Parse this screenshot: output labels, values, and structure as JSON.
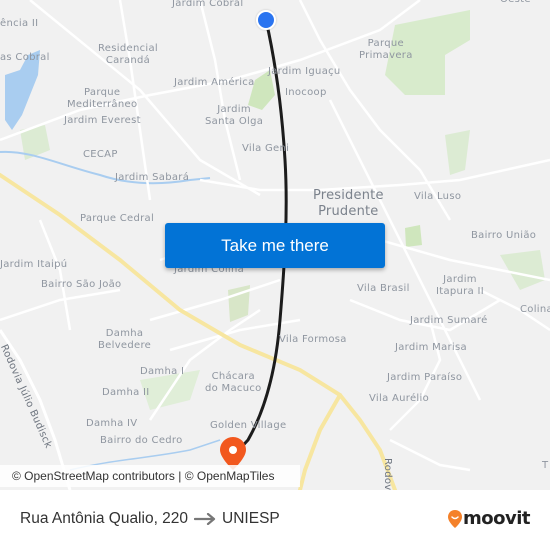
{
  "map": {
    "city_label": [
      "Presidente",
      "Prudente"
    ],
    "labels": [
      {
        "id": "jardim-cobral",
        "text": [
          "Jardim Cobral"
        ]
      },
      {
        "id": "residencia-ii",
        "text": [
          "ência II"
        ]
      },
      {
        "id": "cobral-west",
        "text": [
          "as Cobral"
        ]
      },
      {
        "id": "residencial-caranda",
        "text": [
          "Residencial",
          "Carandá"
        ]
      },
      {
        "id": "parque-mediterraneo",
        "text": [
          "Parque",
          "Mediterrâneo"
        ]
      },
      {
        "id": "jardim-everest",
        "text": [
          "Jardim Everest"
        ]
      },
      {
        "id": "jardim-america",
        "text": [
          "Jardim América"
        ]
      },
      {
        "id": "jardim-santa-olga",
        "text": [
          "Jardim",
          "Santa Olga"
        ]
      },
      {
        "id": "jardim-iguacu",
        "text": [
          "Jardim Iguaçu"
        ]
      },
      {
        "id": "inocoop",
        "text": [
          "Inocoop"
        ]
      },
      {
        "id": "parque-primavera",
        "text": [
          "Parque",
          "Primavera"
        ]
      },
      {
        "id": "oeste",
        "text": [
          "Oeste"
        ]
      },
      {
        "id": "cecap",
        "text": [
          "CECAP"
        ]
      },
      {
        "id": "vila-geni",
        "text": [
          "Vila Geni"
        ]
      },
      {
        "id": "jardim-sabara",
        "text": [
          "Jardim Sabará"
        ]
      },
      {
        "id": "parque-cedral",
        "text": [
          "Parque Cedral"
        ]
      },
      {
        "id": "vila-luso",
        "text": [
          "Vila Luso"
        ]
      },
      {
        "id": "bairro-uniao",
        "text": [
          "Bairro União"
        ]
      },
      {
        "id": "jardim-itaipu",
        "text": [
          "Jardim Itaipú"
        ]
      },
      {
        "id": "jardim-colina",
        "text": [
          "Jardim Colina"
        ]
      },
      {
        "id": "bairro-sao-joao",
        "text": [
          "Bairro São João"
        ]
      },
      {
        "id": "vila-brasil",
        "text": [
          "Vila Brasil"
        ]
      },
      {
        "id": "jardim-itapura-ii",
        "text": [
          "Jardim",
          "Itapura II"
        ]
      },
      {
        "id": "jardim-sumare",
        "text": [
          "Jardim Sumaré"
        ]
      },
      {
        "id": "colina",
        "text": [
          "Colina"
        ]
      },
      {
        "id": "damha-belvedere",
        "text": [
          "Damha",
          "Belvedere"
        ]
      },
      {
        "id": "vila-formosa",
        "text": [
          "Vila Formosa"
        ]
      },
      {
        "id": "jardim-marisa",
        "text": [
          "Jardim Marisa"
        ]
      },
      {
        "id": "damha-i",
        "text": [
          "Damha I"
        ]
      },
      {
        "id": "chacara-do-macuco",
        "text": [
          "Chácara",
          "do Macuco"
        ]
      },
      {
        "id": "jardim-paraiso",
        "text": [
          "Jardim Paraíso"
        ]
      },
      {
        "id": "damha-ii",
        "text": [
          "Damha II"
        ]
      },
      {
        "id": "vila-aurelio",
        "text": [
          "Vila Aurélio"
        ]
      },
      {
        "id": "damha-iv",
        "text": [
          "Damha IV"
        ]
      },
      {
        "id": "golden-village",
        "text": [
          "Golden Village"
        ]
      },
      {
        "id": "bairro-do-cedro",
        "text": [
          "Bairro do Cedro"
        ]
      },
      {
        "id": "t-edge",
        "text": [
          "T"
        ]
      }
    ],
    "roads": {
      "rodovia_julio_budisck": "Rodovia Júlio Budisck",
      "rodovia_east": "Rodovia"
    },
    "attribution": "© OpenStreetMap contributors | © OpenMapTiles",
    "colors": {
      "route": "#1c1c1c",
      "start_pin": "#2a74f0",
      "end_pin": "#f2581e",
      "highway": "#f7e6a0",
      "water": "#a9cdf0",
      "park": "#cfe8c0"
    }
  },
  "cta": {
    "label": "Take me there"
  },
  "footer": {
    "origin": "Rua Antônia Qualio, 220",
    "destination": "UNIESP",
    "brand": "moovit"
  }
}
